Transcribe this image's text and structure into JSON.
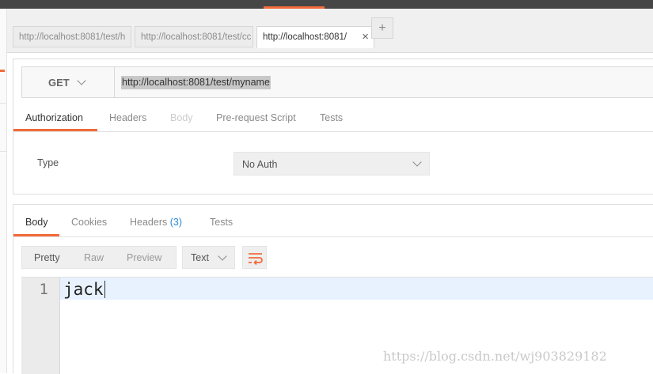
{
  "tabs": [
    {
      "label": "http://localhost:8081/test/h"
    },
    {
      "label": "http://localhost:8081/test/cc"
    },
    {
      "label": "http://localhost:8081/",
      "close": "×"
    }
  ],
  "add_tab": "+",
  "request": {
    "method": "GET",
    "url": "http://localhost:8081/test/myname"
  },
  "request_tabs": [
    "Authorization",
    "Headers",
    "Body",
    "Pre-request Script",
    "Tests"
  ],
  "auth": {
    "type_label": "Type",
    "selected": "No Auth"
  },
  "response_tabs": {
    "body": "Body",
    "cookies": "Cookies",
    "headers": "Headers",
    "headers_count": "(3)",
    "tests": "Tests"
  },
  "view_modes": [
    "Pretty",
    "Raw",
    "Preview"
  ],
  "format": "Text",
  "editor": {
    "line_number": "1",
    "content": "jack"
  },
  "watermark": "https://blog.csdn.net/wj903829182",
  "colors": {
    "accent": "#f26b3a",
    "link": "#2a8ad4",
    "topbar": "#464646"
  }
}
